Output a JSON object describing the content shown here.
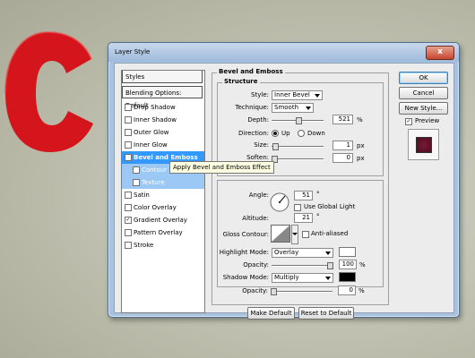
{
  "window": {
    "title": "Layer Style"
  },
  "styles_list": {
    "header": "Styles",
    "blending": "Blending Options: Default",
    "items": [
      {
        "label": "Drop Shadow",
        "checked": false
      },
      {
        "label": "Inner Shadow",
        "checked": false
      },
      {
        "label": "Outer Glow",
        "checked": false
      },
      {
        "label": "Inner Glow",
        "checked": false
      },
      {
        "label": "Bevel and Emboss",
        "checked": true
      },
      {
        "label": "Contour",
        "checked": false
      },
      {
        "label": "Texture",
        "checked": false
      },
      {
        "label": "Satin",
        "checked": false
      },
      {
        "label": "Color Overlay",
        "checked": false
      },
      {
        "label": "Gradient Overlay",
        "checked": true
      },
      {
        "label": "Pattern Overlay",
        "checked": false
      },
      {
        "label": "Stroke",
        "checked": false
      }
    ]
  },
  "panel": {
    "title": "Bevel and Emboss",
    "structure": {
      "title": "Structure",
      "style_label": "Style:",
      "style_value": "Inner Bevel",
      "technique_label": "Technique:",
      "technique_value": "Smooth",
      "depth_label": "Depth:",
      "depth_value": "521",
      "depth_unit": "%",
      "depth_level": 0.52,
      "direction_label": "Direction:",
      "direction_up": "Up",
      "direction_down": "Down",
      "size_label": "Size:",
      "size_value": "1",
      "size_unit": "px",
      "size_level": 0.01,
      "soften_label": "Soften:",
      "soften_value": "0",
      "soften_unit": "px",
      "soften_level": 0
    },
    "shading": {
      "angle_label": "Angle:",
      "angle_value": "51",
      "angle_unit": "°",
      "global_light": "Use Global Light",
      "altitude_label": "Altitude:",
      "altitude_value": "21",
      "altitude_unit": "°",
      "gloss_label": "Gloss Contour:",
      "antialiased": "Anti-aliased",
      "highlight_label": "Highlight Mode:",
      "highlight_mode": "Overlay",
      "highlight_color": "#ffffff",
      "hl_opacity_label": "Opacity:",
      "hl_opacity_value": "100",
      "hl_opacity_unit": "%",
      "hl_opacity_level": 1,
      "shadow_label": "Shadow Mode:",
      "shadow_mode": "Multiply",
      "shadow_color": "#000000",
      "sh_opacity_label": "Opacity:",
      "sh_opacity_value": "0",
      "sh_opacity_unit": "%",
      "sh_opacity_level": 0
    },
    "make_default": "Make Default",
    "reset_default": "Reset to Default"
  },
  "buttons": {
    "ok": "OK",
    "cancel": "Cancel",
    "new_style": "New Style...",
    "preview": "Preview",
    "close": "x"
  },
  "tooltip": "Apply Bevel and Emboss Effect",
  "colors": {
    "accent": "#3399ff",
    "preview_swatch": "#7a1a35",
    "letter": "#d4151c"
  }
}
